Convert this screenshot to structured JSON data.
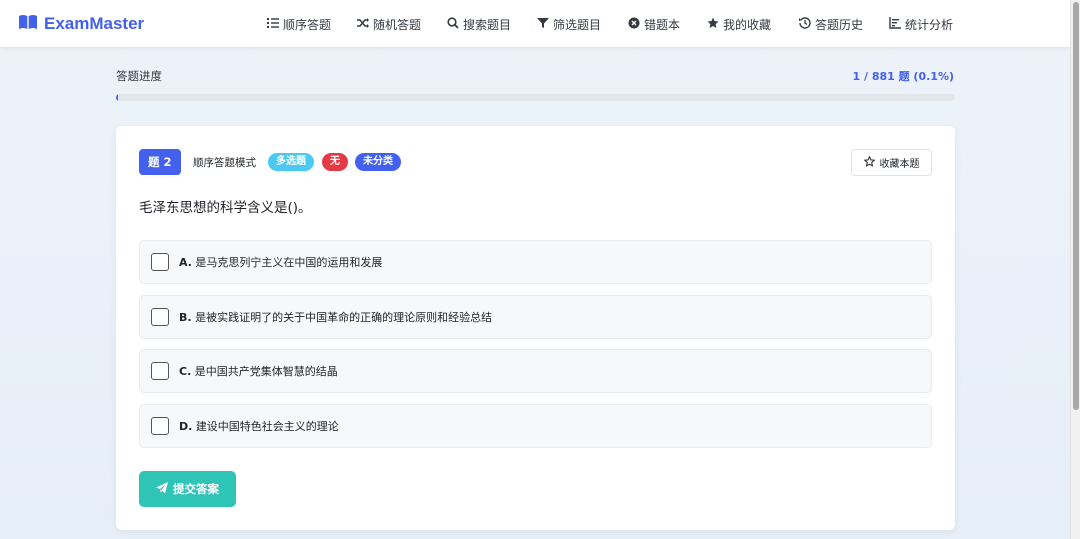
{
  "brand": {
    "name": "ExamMaster",
    "color": "#4361ee",
    "icon": "book-open-icon"
  },
  "nav": [
    {
      "label": "顺序答题",
      "icon": "list-ordered-icon"
    },
    {
      "label": "随机答题",
      "icon": "shuffle-icon"
    },
    {
      "label": "搜索题目",
      "icon": "search-icon"
    },
    {
      "label": "筛选题目",
      "icon": "filter-icon"
    },
    {
      "label": "错题本",
      "icon": "x-circle-icon"
    },
    {
      "label": "我的收藏",
      "icon": "star-icon"
    },
    {
      "label": "答题历史",
      "icon": "history-icon"
    },
    {
      "label": "统计分析",
      "icon": "chart-icon"
    }
  ],
  "progress": {
    "label": "答题进度",
    "count_text": "1 / 881 题 (0.1%)",
    "fraction": 0.001
  },
  "question": {
    "number_label": "题 2",
    "mode": "顺序答题模式",
    "badges": [
      {
        "label": "多选题",
        "color": "#4cc9f0"
      },
      {
        "label": "无",
        "color": "#e63946"
      },
      {
        "label": "未分类",
        "color": "#4361ee"
      }
    ],
    "favorite_label": "收藏本题",
    "text": "毛泽东思想的科学含义是()。",
    "options": [
      {
        "letter": "A.",
        "text": "是马克思列宁主义在中国的运用和发展"
      },
      {
        "letter": "B.",
        "text": "是被实践证明了的关于中国革命的正确的理论原则和经验总结"
      },
      {
        "letter": "C.",
        "text": "是中国共产党集体智慧的结晶"
      },
      {
        "letter": "D.",
        "text": "建设中国特色社会主义的理论"
      }
    ],
    "submit_label": "提交答案"
  },
  "colors": {
    "primary": "#4361ee",
    "submit": "#2ec4b6"
  }
}
